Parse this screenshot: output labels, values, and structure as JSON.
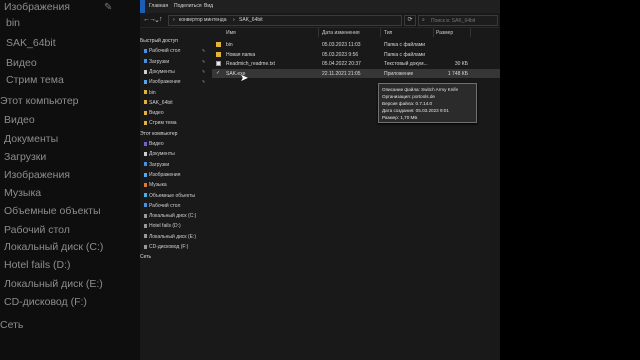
{
  "backdrop": {
    "items": [
      "Изображения",
      "bin",
      "SAK_64bit",
      "Видео",
      "Стрим тема",
      "Этот компьютер",
      "Видео",
      "Документы",
      "Загрузки",
      "Изображения",
      "Музыка",
      "Объемные объекты",
      "Рабочий стол",
      "Локальный диск (C:)",
      "Hotel fails (D:)",
      "Локальный диск (E:)",
      "CD-дисковод (F:)",
      "Сеть"
    ]
  },
  "menu": {
    "home": "Главная",
    "share": "Поделиться",
    "view": "Вид"
  },
  "address": {
    "nav_back": "←",
    "nav_forward": "→",
    "nav_recent": "⌄",
    "nav_up": "↑",
    "crumbs": [
      "конвертор минтенда",
      "SAK_64bit"
    ],
    "crumb_sep": "›",
    "search_placeholder": "Поиск в: SAK_64bit",
    "refresh": "⟳",
    "search_icon_glyph": "⌕"
  },
  "nav_pane": {
    "quick_access": "Быстрый доступ",
    "items": [
      {
        "label": "Рабочий стол",
        "pinned": true,
        "color": "#4a8fe0"
      },
      {
        "label": "Загрузки",
        "pinned": true,
        "color": "#4a8fe0"
      },
      {
        "label": "Документы",
        "pinned": true,
        "color": "#cfcfcf"
      },
      {
        "label": "Изображения",
        "pinned": true,
        "color": "#5aa7e8"
      },
      {
        "label": "bin",
        "pinned": false,
        "color": "#e3b341"
      },
      {
        "label": "SAK_64bit",
        "pinned": false,
        "color": "#e3b341"
      },
      {
        "label": "Видео",
        "pinned": false,
        "color": "#e3b341"
      },
      {
        "label": "Стрим тема",
        "pinned": false,
        "color": "#e3b341"
      }
    ],
    "this_pc": "Этот компьютер",
    "pc_items": [
      {
        "label": "Видео",
        "color": "#7a5fd0"
      },
      {
        "label": "Документы",
        "color": "#cfcfcf"
      },
      {
        "label": "Загрузки",
        "color": "#4a8fe0"
      },
      {
        "label": "Изображения",
        "color": "#5aa7e8"
      },
      {
        "label": "Музыка",
        "color": "#e07a3a"
      },
      {
        "label": "Объемные объекты",
        "color": "#4ab0e0"
      },
      {
        "label": "Рабочий стол",
        "color": "#4a8fe0"
      },
      {
        "label": "Локальный диск (C:)",
        "color": "#9a9a9a"
      },
      {
        "label": "Hotel fails (D:)",
        "color": "#9a9a9a"
      },
      {
        "label": "Локальный диск (E:)",
        "color": "#9a9a9a"
      },
      {
        "label": "CD-дисковод (F:)",
        "color": "#9a9a9a"
      }
    ],
    "network": "Сеть",
    "pin_glyph": "✎"
  },
  "columns": {
    "name": "Имя",
    "date": "Дата изменения",
    "type": "Тип",
    "size": "Размер"
  },
  "files": [
    {
      "name": "bin",
      "date": "05.03.2023 11:03",
      "type": "Папка с файлами",
      "size": "",
      "kind": "folder"
    },
    {
      "name": "Новая папка",
      "date": "05.03.2023 9:56",
      "type": "Папка с файлами",
      "size": "",
      "kind": "folder"
    },
    {
      "name": "Readmich_readme.txt",
      "date": "05.04.2022 20:37",
      "type": "Текстовый докум...",
      "size": "30 КБ",
      "kind": "txt"
    },
    {
      "name": "SAK.exe",
      "date": "22.11.2021 21:05",
      "type": "Приложение",
      "size": "1 748 КБ",
      "kind": "exe"
    }
  ],
  "tooltip": {
    "desc": "Описание файла: Switch Army Knife",
    "org": "Организация: portools.de",
    "version": "Версия файла: 0.7.14.0",
    "created": "Дата создания: 05.03.2023 9:01",
    "size": "Размер: 1,70 МБ"
  },
  "exe_icon_glyph": "✓",
  "cursor_glyph": "➤"
}
